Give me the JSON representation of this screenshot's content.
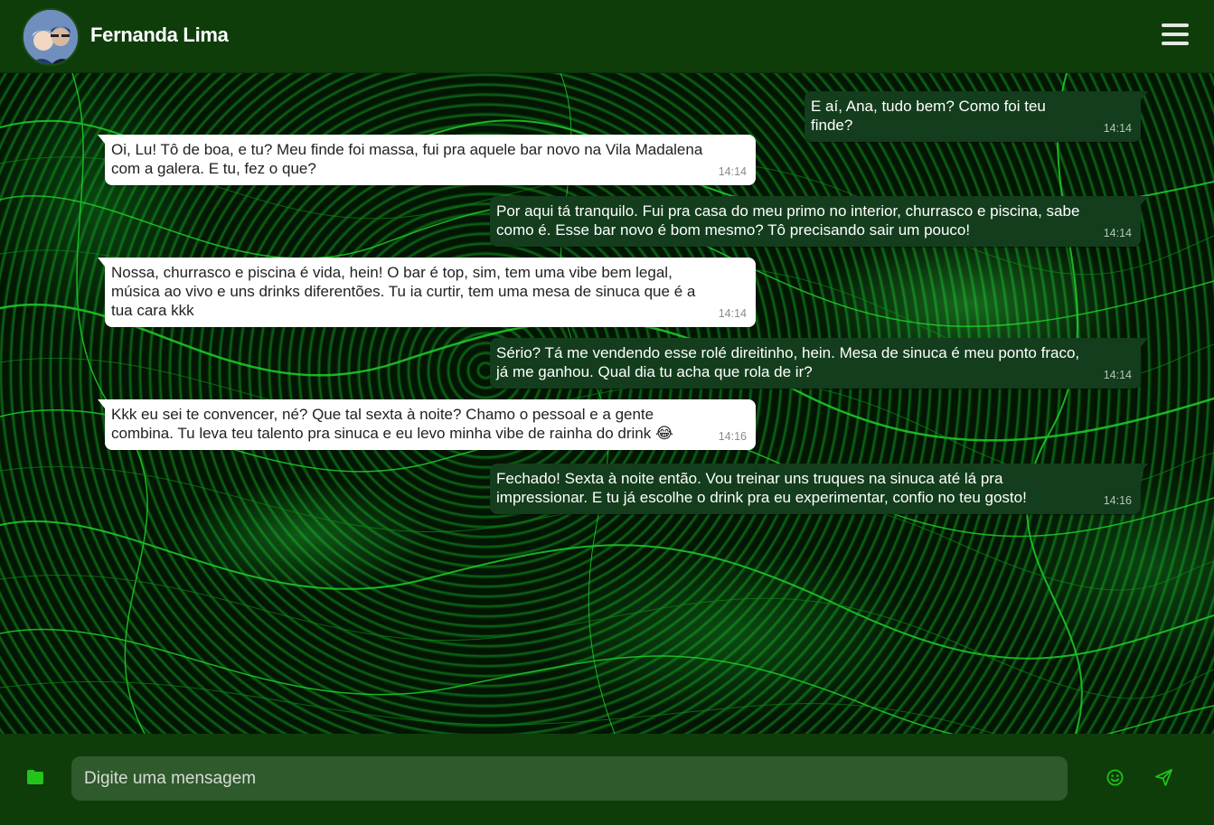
{
  "header": {
    "contact_name": "Fernanda Lima"
  },
  "messages": [
    {
      "direction": "out",
      "text": "E aí, Ana, tudo bem? Como foi teu finde?",
      "time": "14:14"
    },
    {
      "direction": "in",
      "text": "Oi, Lu! Tô de boa, e tu? Meu finde foi massa, fui pra aquele bar novo na Vila Madalena com a galera. E tu, fez o que?",
      "time": "14:14"
    },
    {
      "direction": "out",
      "text": "Por aqui tá tranquilo. Fui pra casa do meu primo no interior, churrasco e piscina, sabe como é. Esse bar novo é bom mesmo? Tô precisando sair um pouco!",
      "time": "14:14"
    },
    {
      "direction": "in",
      "text": "Nossa, churrasco e piscina é vida, hein! O bar é top, sim, tem uma vibe bem legal, música ao vivo e uns drinks diferentões. Tu ia curtir, tem uma mesa de sinuca que é a tua cara kkk",
      "time": "14:14"
    },
    {
      "direction": "out",
      "text": "Sério? Tá me vendendo esse rolé direitinho, hein. Mesa de sinuca é meu ponto fraco, já me ganhou. Qual dia tu acha que rola de ir?",
      "time": "14:14"
    },
    {
      "direction": "in",
      "text": "Kkk eu sei te convencer, né? Que tal sexta à noite? Chamo o pessoal e a gente combina. Tu leva teu talento pra sinuca e eu levo minha vibe de rainha do drink 😂",
      "time": "14:16"
    },
    {
      "direction": "out",
      "text": "Fechado! Sexta à noite então. Vou treinar uns truques na sinuca até lá pra impressionar. E tu já escolhe o drink pra eu experimentar, confio no teu gosto!",
      "time": "14:16"
    }
  ],
  "composer": {
    "placeholder": "Digite uma mensagem"
  },
  "icons": {
    "attach": "folder-icon",
    "emoji": "smiley-icon",
    "send": "send-icon",
    "menu": "hamburger-menu-icon"
  },
  "colors": {
    "header_bg": "#0e3d0a",
    "outgoing_bubble": "#133d1c",
    "incoming_bubble": "#ffffff",
    "accent": "#22c41a",
    "input_bg": "#2f5a2c"
  }
}
